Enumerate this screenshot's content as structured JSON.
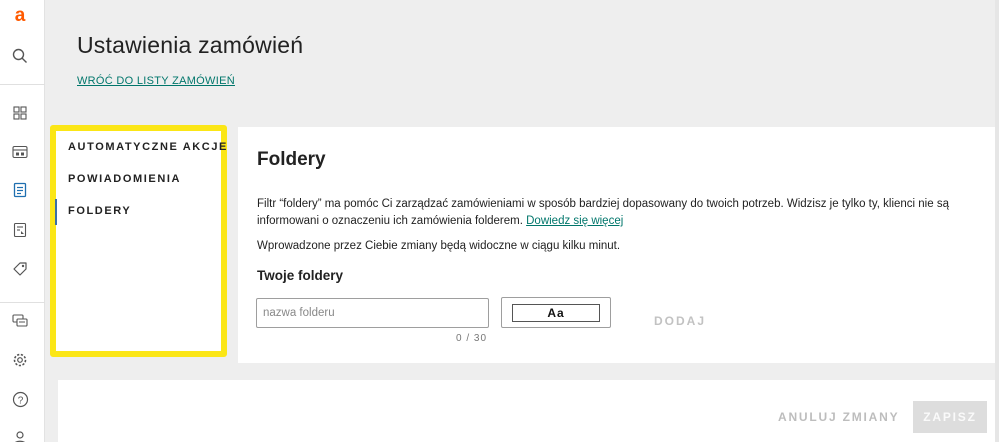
{
  "brand": {
    "logo_letter": "a",
    "accent_color": "#ff5a00"
  },
  "rail": {
    "icons": [
      "search-icon",
      "dashboard-icon",
      "shop-icon",
      "orders-icon",
      "offers-icon",
      "tag-icon",
      "messages-icon",
      "settings-icon",
      "help-icon",
      "user-icon"
    ]
  },
  "page": {
    "title": "Ustawienia zamówień",
    "back_link": "WRÓĆ DO LISTY ZAMÓWIEŃ"
  },
  "nav": {
    "items": [
      {
        "label": "AUTOMATYCZNE AKCJE",
        "active": false
      },
      {
        "label": "POWIADOMIENIA",
        "active": false
      },
      {
        "label": "FOLDERY",
        "active": true
      }
    ],
    "highlight_color": "#fbe616"
  },
  "section": {
    "title": "Foldery",
    "description": "Filtr “foldery” ma pomóc Ci zarządzać zamówieniami w sposób bardziej dopasowany do twoich potrzeb. Widzisz je tylko ty, klienci nie są informowani o oznaczeniu ich zamówienia folderem.",
    "learn_more": "Dowiedz się więcej",
    "note": "Wprowadzone przez Ciebie zmiany będą widoczne w ciągu kilku minut.",
    "subtitle": "Twoje foldery",
    "folder_input": {
      "value": "",
      "placeholder": "nazwa folderu"
    },
    "counter": "0 / 30",
    "color_select_label": "Aa",
    "add_label": "DODAJ"
  },
  "actions": {
    "cancel_label": "ANULUJ ZMIANY",
    "save_label": "ZAPISZ"
  }
}
